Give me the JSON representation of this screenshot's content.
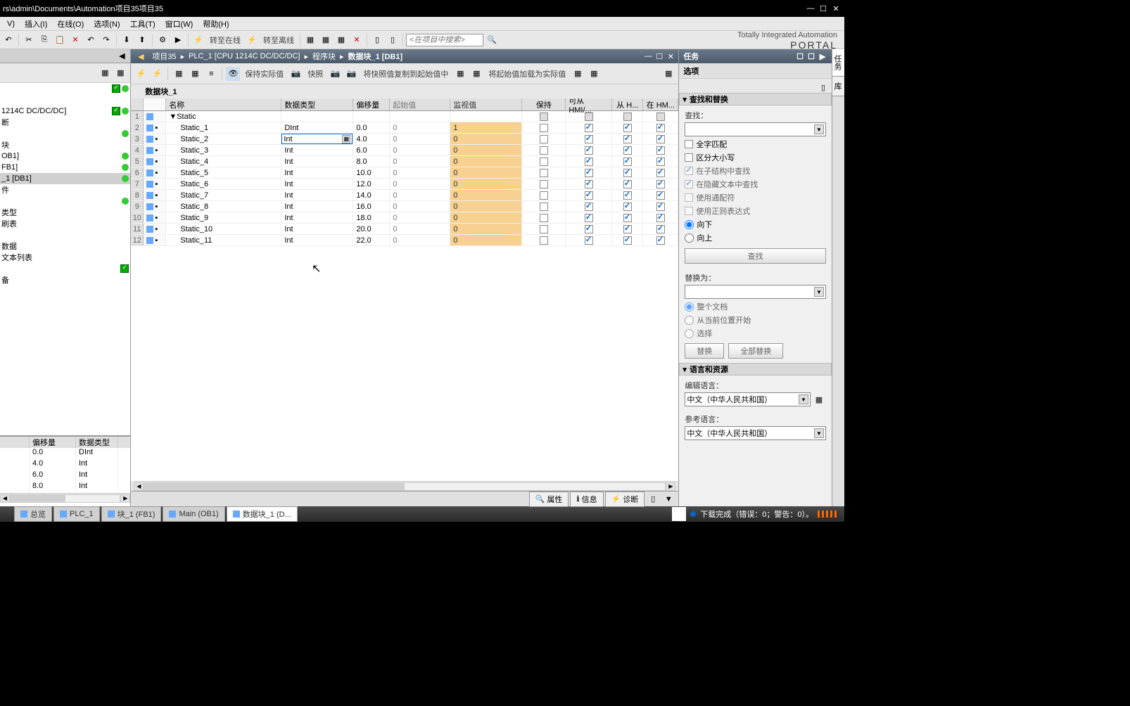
{
  "title": "rs\\admin\\Documents\\Automation项目35项目35",
  "menus": [
    "V)",
    "插入(I)",
    "在线(O)",
    "选项(N)",
    "工具(T)",
    "窗口(W)",
    "帮助(H)"
  ],
  "toolbar": {
    "go_online": "转至在线",
    "go_offline": "转至离线",
    "search_placeholder": "<在项目中搜索>"
  },
  "brand": {
    "line1": "Totally Integrated Automation",
    "line2": "PORTAL"
  },
  "breadcrumb": [
    "项目35",
    "PLC_1 [CPU 1214C DC/DC/DC]",
    "程序块",
    "数据块_1 [DB1]"
  ],
  "tree": {
    "items": [
      {
        "label": "",
        "check": true,
        "dot": true
      },
      {
        "label": "",
        "check": false,
        "dot": false
      },
      {
        "label": "1214C DC/DC/DC]",
        "check": true,
        "dot": true
      },
      {
        "label": "断",
        "check": false,
        "dot": false
      },
      {
        "label": "",
        "check": false,
        "dot": true
      },
      {
        "label": "块",
        "check": false,
        "dot": false
      },
      {
        "label": "OB1]",
        "check": false,
        "dot": true
      },
      {
        "label": "FB1]",
        "check": false,
        "dot": true
      },
      {
        "label": "_1 [DB1]",
        "check": false,
        "dot": true,
        "sel": true
      },
      {
        "label": "件",
        "check": false,
        "dot": false
      },
      {
        "label": "",
        "check": false,
        "dot": true
      },
      {
        "label": "类型",
        "check": false,
        "dot": false
      },
      {
        "label": "刷表",
        "check": false,
        "dot": false
      },
      {
        "label": "",
        "check": false,
        "dot": false
      },
      {
        "label": "数据",
        "check": false,
        "dot": false
      },
      {
        "label": "文本列表",
        "check": false,
        "dot": false
      },
      {
        "label": "",
        "check": true,
        "dot": false
      },
      {
        "label": "备",
        "check": false,
        "dot": false
      }
    ]
  },
  "bottom_table": {
    "headers": [
      "偏移量",
      "数据类型"
    ],
    "rows": [
      {
        "offset": "0.0",
        "type": "DInt"
      },
      {
        "offset": "4.0",
        "type": "Int"
      },
      {
        "offset": "6.0",
        "type": "Int"
      },
      {
        "offset": "8.0",
        "type": "Int"
      }
    ]
  },
  "editor_toolbar": {
    "keep_actual": "保持实际值",
    "snapshot": "快照",
    "copy_snapshot": "将快照值复制到起始值中",
    "load_start": "将起始值加载为实际值"
  },
  "block_title": "数据块_1",
  "db": {
    "headers": [
      "名称",
      "数据类型",
      "偏移量",
      "起始值",
      "监视值",
      "保持",
      "可从 HMI/...",
      "从 H...",
      "在 HM..."
    ],
    "static_label": "Static",
    "rows": [
      {
        "n": 2,
        "name": "Static_1",
        "type": "DInt",
        "offset": "0.0",
        "start": "0",
        "monitor": "1"
      },
      {
        "n": 3,
        "name": "Static_2",
        "type": "Int",
        "offset": "4.0",
        "start": "0",
        "monitor": "0",
        "editing": true
      },
      {
        "n": 4,
        "name": "Static_3",
        "type": "Int",
        "offset": "6.0",
        "start": "0",
        "monitor": "0"
      },
      {
        "n": 5,
        "name": "Static_4",
        "type": "Int",
        "offset": "8.0",
        "start": "0",
        "monitor": "0"
      },
      {
        "n": 6,
        "name": "Static_5",
        "type": "Int",
        "offset": "10.0",
        "start": "0",
        "monitor": "0"
      },
      {
        "n": 7,
        "name": "Static_6",
        "type": "Int",
        "offset": "12.0",
        "start": "0",
        "monitor": "0"
      },
      {
        "n": 8,
        "name": "Static_7",
        "type": "Int",
        "offset": "14.0",
        "start": "0",
        "monitor": "0"
      },
      {
        "n": 9,
        "name": "Static_8",
        "type": "Int",
        "offset": "16.0",
        "start": "0",
        "monitor": "0"
      },
      {
        "n": 10,
        "name": "Static_9",
        "type": "Int",
        "offset": "18.0",
        "start": "0",
        "monitor": "0"
      },
      {
        "n": 11,
        "name": "Static_10",
        "type": "Int",
        "offset": "20.0",
        "start": "0",
        "monitor": "0"
      },
      {
        "n": 12,
        "name": "Static_11",
        "type": "Int",
        "offset": "22.0",
        "start": "0",
        "monitor": "0"
      }
    ]
  },
  "info_tabs": [
    "属性",
    "信息",
    "诊断"
  ],
  "right": {
    "title": "任务",
    "options": "选项",
    "find_replace": "查找和替换",
    "find_label": "查找：",
    "chk_whole": "全字匹配",
    "chk_case": "区分大小写",
    "chk_sub": "在子结构中查找",
    "chk_hidden": "在隐藏文本中查找",
    "chk_wildcard": "使用通配符",
    "chk_regex": "使用正则表达式",
    "radio_down": "向下",
    "radio_up": "向上",
    "find_btn": "查找",
    "replace_label": "替换为：",
    "radio_whole_doc": "整个文档",
    "radio_from_pos": "从当前位置开始",
    "radio_select": "选择",
    "replace_btn": "替换",
    "replace_all_btn": "全部替换",
    "lang_res": "语言和资源",
    "edit_lang": "编辑语言：",
    "ref_lang": "参考语言：",
    "lang_value": "中文（中华人民共和国）"
  },
  "side_tabs": [
    "任务",
    "库"
  ],
  "statusbar": {
    "tabs": [
      {
        "label": "总览",
        "active": false
      },
      {
        "label": "PLC_1",
        "active": false
      },
      {
        "label": "块_1 (FB1)",
        "active": false
      },
      {
        "label": "Main (OB1)",
        "active": false
      },
      {
        "label": "数据块_1 (D...",
        "active": true
      }
    ],
    "status": "下载完成（错误：0；警告：0）。"
  }
}
